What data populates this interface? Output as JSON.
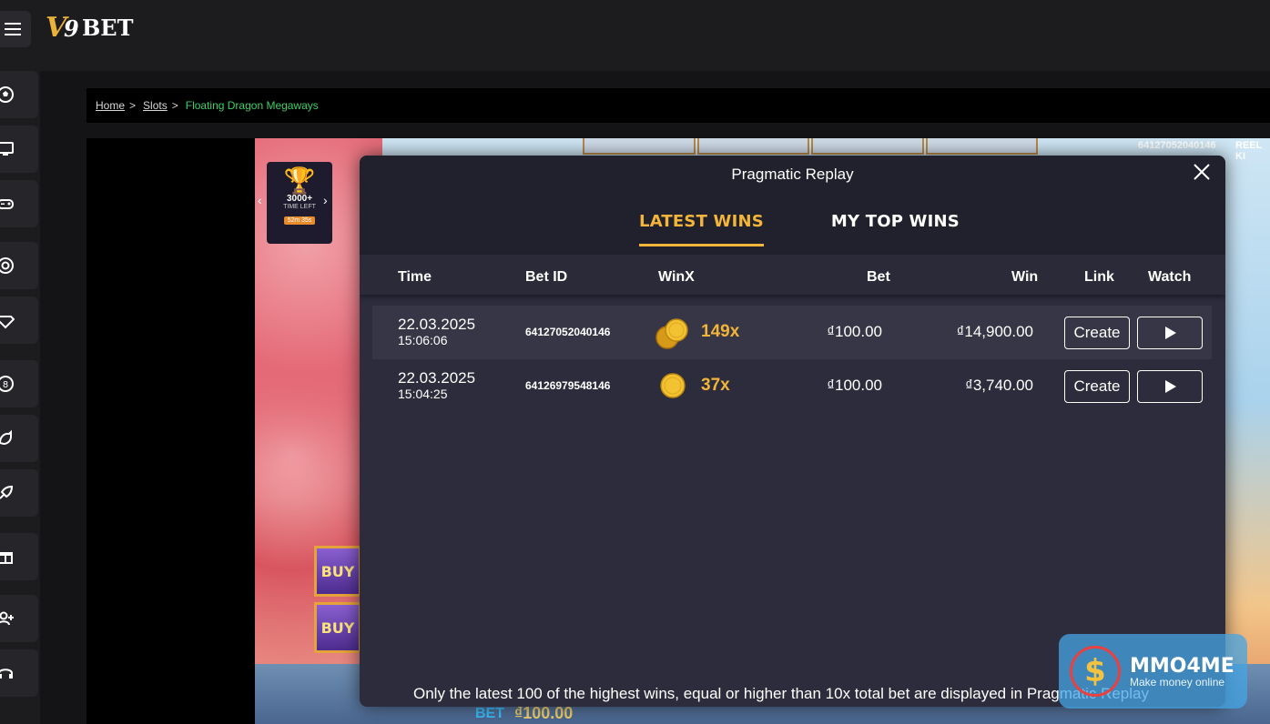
{
  "brand": {
    "logo_text": "BET",
    "logo_mark_v": "V",
    "logo_mark_num": "9"
  },
  "breadcrumb": {
    "home": "Home",
    "slots": "Slots",
    "current": "Floating Dragon Megaways",
    "separator": ">"
  },
  "game": {
    "bet_id_overlay": "64127052040146",
    "reel_kingdom_partial": "REEL KI",
    "tournament": {
      "count": "3000+",
      "label": "TIME LEFT",
      "time": "52m 35s"
    },
    "buy_label": "BUY",
    "bet_label": "BET",
    "bet_value": "₫100.00"
  },
  "modal": {
    "title": "Pragmatic Replay",
    "tabs": [
      {
        "label": "LATEST WINS",
        "active": true
      },
      {
        "label": "MY TOP WINS",
        "active": false
      }
    ],
    "columns": {
      "time": "Time",
      "bet_id": "Bet ID",
      "winx": "WinX",
      "bet": "Bet",
      "win": "Win",
      "link": "Link",
      "watch": "Watch"
    },
    "rows": [
      {
        "date": "22.03.2025",
        "time": "15:06:06",
        "bet_id": "64127052040146",
        "winx": "149x",
        "bet": "₫100.00",
        "win": "₫14,900.00",
        "create": "Create",
        "coins": 2
      },
      {
        "date": "22.03.2025",
        "time": "15:04:25",
        "bet_id": "64126979548146",
        "winx": "37x",
        "bet": "₫100.00",
        "win": "₫3,740.00",
        "create": "Create",
        "coins": 1
      }
    ],
    "footnote": "Only the latest 100 of the highest wins, equal or higher than 10x total bet are displayed in Pragmatic Replay"
  },
  "watermark": {
    "name": "MMO4ME",
    "tagline": "Make money online",
    "symbol": "$"
  },
  "colors": {
    "accent": "#f2b53a",
    "breadcrumb_current": "#3ccf6a",
    "modal_bg": "#2c2c3c"
  }
}
